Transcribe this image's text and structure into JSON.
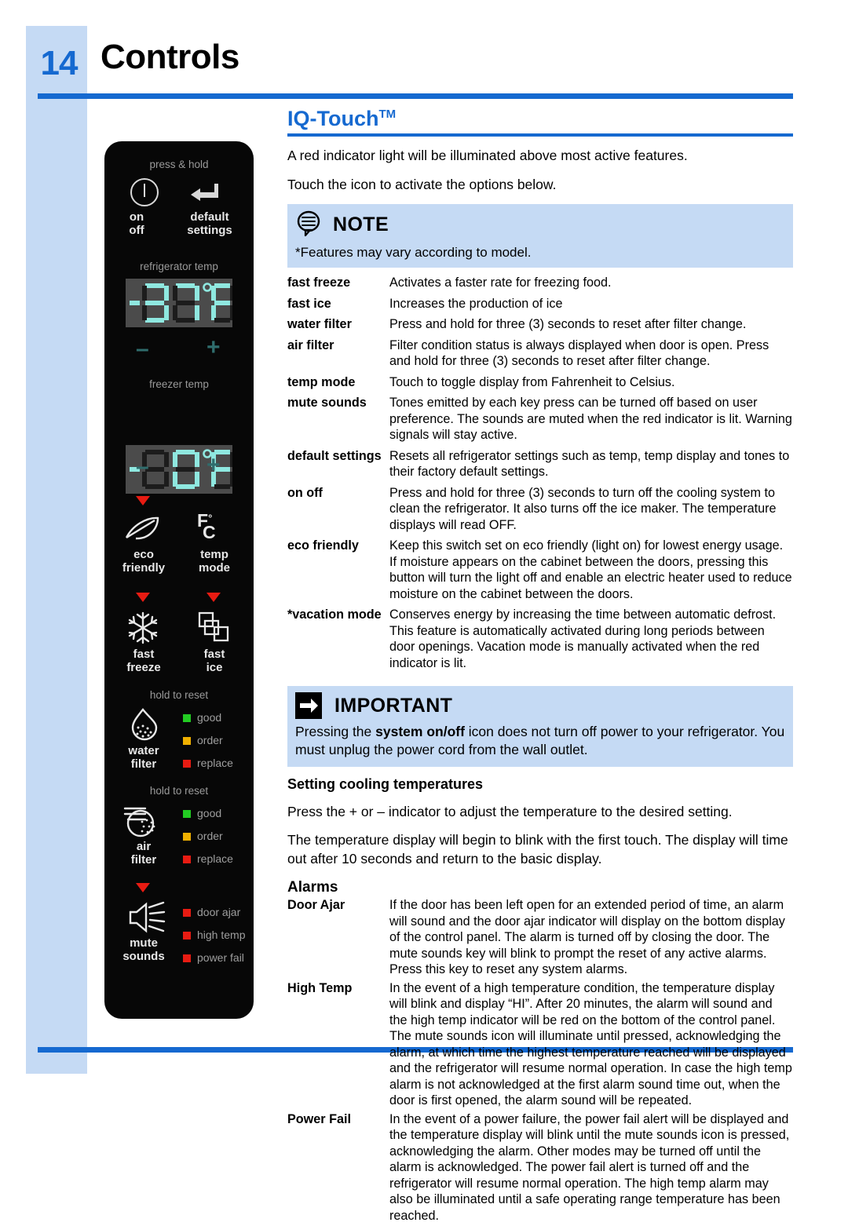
{
  "page": {
    "number": "14",
    "title": "Controls",
    "accent_color": "#1569d0",
    "band_color": "#c5daf4"
  },
  "section": {
    "heading": "IQ-Touch",
    "heading_tm": "TM",
    "lead1": "A red indicator light will be illuminated above most active features.",
    "lead2": "Touch the icon to activate the options below."
  },
  "note": {
    "title": "NOTE",
    "body": "*Features may vary according to model."
  },
  "important": {
    "title": "IMPORTANT",
    "body_pre": "Pressing the ",
    "body_bold": "system on/off",
    "body_post": " icon does not turn off power to your refrigerator. You must unplug the power cord from the wall outlet."
  },
  "features": [
    {
      "term": "fast freeze",
      "desc": "Activates a faster rate for freezing food."
    },
    {
      "term": "fast ice",
      "desc": "Increases the production of ice"
    },
    {
      "term": "water filter",
      "desc": "Press and hold for three (3) seconds to reset after filter change."
    },
    {
      "term": "air filter",
      "desc": "Filter condition status is always displayed when door is open. Press and hold for three (3) seconds to reset after filter change."
    },
    {
      "term": "temp mode",
      "desc": "Touch to toggle display from Fahrenheit to Celsius."
    },
    {
      "term": "mute sounds",
      "desc": "Tones emitted by each key press can be turned off based on user preference. The sounds are muted when the red indicator is lit. Warning signals will stay active."
    },
    {
      "term": "default settings",
      "desc": "Resets all refrigerator settings such as temp, temp display and tones to their factory default settings."
    },
    {
      "term": "on off",
      "desc": "Press and hold for three (3) seconds to turn off the cooling system  to clean the refrigerator. It also turns off the ice maker. The temperature displays will read OFF."
    },
    {
      "term": "eco friendly",
      "desc": "Keep this switch set on eco friendly (light on) for lowest energy usage. If moisture appears on the cabinet between the doors, pressing this button will turn the light off and enable an electric heater used to reduce moisture on the cabinet between the doors."
    },
    {
      "term": "*vacation mode",
      "desc": "Conserves energy by increasing the time between automatic defrost. This feature is automatically activated during long periods between door openings. Vacation mode is manually activated when the red indicator is lit."
    }
  ],
  "cooling": {
    "heading": "Setting cooling temperatures",
    "para1": "Press the + or – indicator to adjust the temperature to the desired setting.",
    "para2": "The temperature display will begin to blink with the first touch. The display will time out after 10 seconds and return to the basic display."
  },
  "alarms": {
    "heading": "Alarms",
    "items": [
      {
        "term": "Door Ajar",
        "desc": "If the door has been left open for an extended period of time, an alarm will sound and the door ajar indicator will display on the bottom display of the control panel. The alarm is turned off by closing the door. The mute sounds key will blink to prompt the reset of any active alarms. Press this key to reset any system alarms."
      },
      {
        "term": "High Temp",
        "desc": "In the event of a high temperature condition, the temperature display will blink and display “HI”.  After 20 minutes, the alarm will sound and the high temp indicator will be red on the bottom of the control panel.  The mute sounds icon will illuminate until pressed, acknowledging the alarm, at which time the highest temperature reached will be displayed and the refrigerator will resume normal operation.  In case the high temp alarm is not acknowledged at the first alarm sound time out, when the door is first opened, the alarm sound will be repeated."
      },
      {
        "term": "Power Fail",
        "desc": "In the event of a power failure, the power fail alert will be displayed and the temperature display will blink until the mute sounds icon is pressed, acknowledging the alarm. Other modes may be turned off until the alarm is acknowledged. The power fail alert is turned off and the refrigerator will resume normal operation. The high temp alarm may also be illuminated until a safe operating range temperature has been reached."
      }
    ]
  },
  "control_panel": {
    "press_hold": "press & hold",
    "on_off_label": "on\noff",
    "on_off_line1": "on",
    "on_off_line2": "off",
    "default_line1": "default",
    "default_line2": "settings",
    "refrigerator_temp_label": "refrigerator temp",
    "refrigerator_temp_value": "37°F",
    "freezer_temp_label": "freezer temp",
    "freezer_temp_value": "-0°F",
    "minus": "–",
    "plus": "+",
    "eco_line1": "eco",
    "eco_line2": "friendly",
    "temp_mode_line1": "temp",
    "temp_mode_line2": "mode",
    "temp_mode_icon_f": "F",
    "temp_mode_icon_deg": "°",
    "temp_mode_icon_c": "C",
    "fast_freeze_line1": "fast",
    "fast_freeze_line2": "freeze",
    "fast_ice_line1": "fast",
    "fast_ice_line2": "ice",
    "hold_to_reset": "hold to reset",
    "water_filter_line1": "water",
    "water_filter_line2": "filter",
    "air_filter_line1": "air",
    "air_filter_line2": "filter",
    "mute_line1": "mute",
    "mute_line2": "sounds",
    "status_good": "good",
    "status_order": "order",
    "status_replace": "replace",
    "alarm_door_ajar": "door ajar",
    "alarm_high_temp": "high temp",
    "alarm_power_fail": "power fail",
    "led_good_color": "#22cc22",
    "led_order_color": "#f0b000",
    "led_replace_color": "#e81b12",
    "indicator_color": "#e81b12",
    "display_text_color": "#8fe8e0"
  }
}
